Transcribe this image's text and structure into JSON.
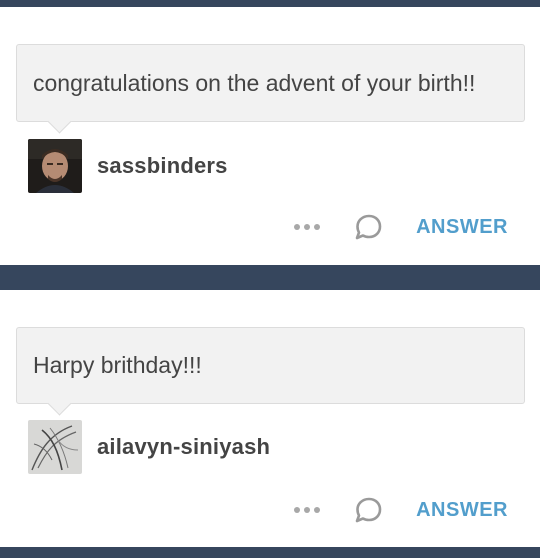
{
  "asks": [
    {
      "question": "congratulations on the advent of your birth!!",
      "username": "sassbinders",
      "avatar_icon": "user-avatar-photo",
      "more_icon": "more-dots-icon",
      "reply_icon": "reply-bubble-icon",
      "answer_label": "ANSWER"
    },
    {
      "question": "Harpy brithday!!!",
      "username": "ailavyn-siniyash",
      "avatar_icon": "user-avatar-sketch",
      "more_icon": "more-dots-icon",
      "reply_icon": "reply-bubble-icon",
      "answer_label": "ANSWER"
    }
  ],
  "colors": {
    "background": "#36465d",
    "answer": "#529ecc",
    "bubble": "#f2f2f2"
  }
}
